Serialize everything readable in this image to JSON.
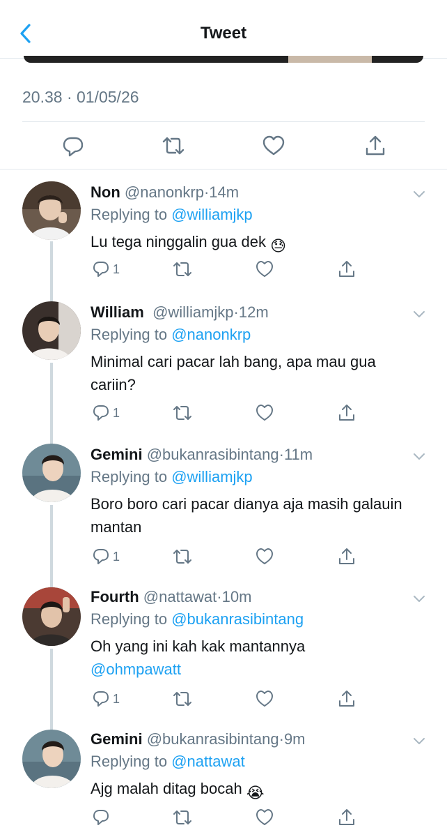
{
  "header": {
    "title": "Tweet"
  },
  "main_tweet": {
    "timestamp": "20.38 · 01/05/26"
  },
  "tweets": [
    {
      "name": "Non",
      "handle": "@nanonkrp",
      "time": "14m",
      "replying_prefix": "Replying to ",
      "replying_to": "@williamjkp",
      "text": "Lu tega ninggalin gua dek",
      "emoji": "😓",
      "reply_count": "1"
    },
    {
      "name": "William",
      "handle": "@williamjkp",
      "time": "12m",
      "replying_prefix": "Replying to ",
      "replying_to": "@nanonkrp",
      "text": "Minimal cari pacar lah bang, apa mau gua cariin?",
      "reply_count": "1"
    },
    {
      "name": "Gemini",
      "handle": "@bukanrasibintang",
      "time": "11m",
      "replying_prefix": "Replying to ",
      "replying_to": "@williamjkp",
      "text": "Boro boro cari pacar dianya aja masih galauin mantan",
      "reply_count": "1"
    },
    {
      "name": "Fourth",
      "handle": "@nattawat",
      "time": "10m",
      "replying_prefix": "Replying to ",
      "replying_to": "@bukanrasibintang",
      "text": "Oh yang ini kah kak mantannya",
      "mention": "@ohmpawatt",
      "reply_count": "1"
    },
    {
      "name": "Gemini",
      "handle": "@bukanrasibintang",
      "time": "9m",
      "replying_prefix": "Replying to ",
      "replying_to": "@nattawat",
      "text": "Ajg malah ditag bocah",
      "emoji": "😭"
    }
  ],
  "colors": {
    "link": "#1da1f2",
    "muted": "#657786",
    "text": "#14171a",
    "divider": "#e1e8ed",
    "thread": "#cfd9de"
  }
}
